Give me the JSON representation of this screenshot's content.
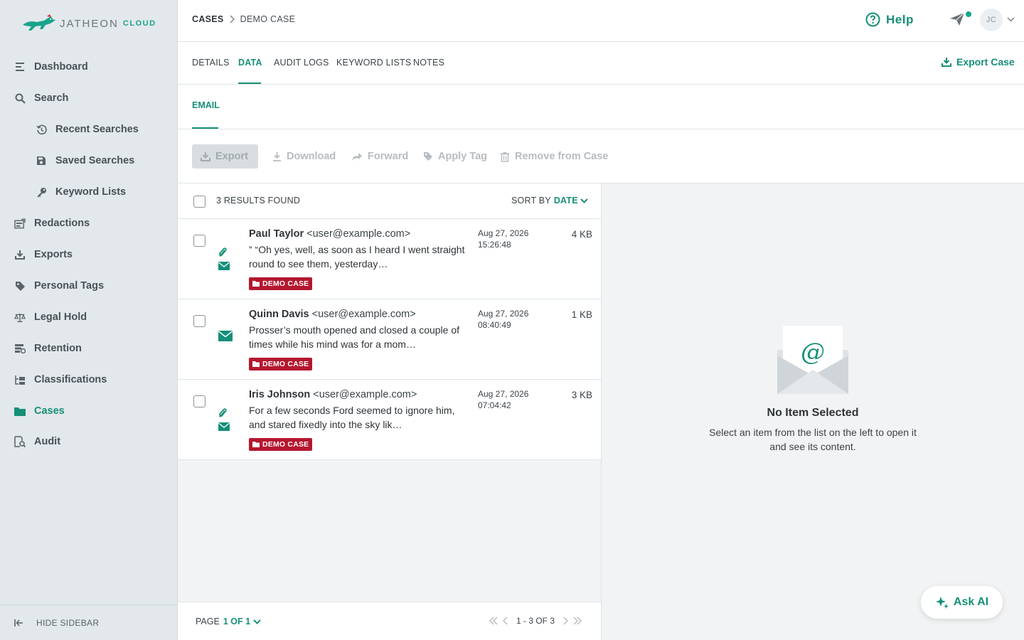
{
  "brand": {
    "name": "JATHEON",
    "sub": "CLOUD",
    "accent": "#168f78"
  },
  "sidebar": {
    "items": [
      {
        "label": "Dashboard",
        "icon": "dashboard-icon"
      },
      {
        "label": "Search",
        "icon": "search-icon"
      },
      {
        "label": "Recent Searches",
        "icon": "history-icon"
      },
      {
        "label": "Saved Searches",
        "icon": "save-icon"
      },
      {
        "label": "Keyword Lists",
        "icon": "key-icon"
      },
      {
        "label": "Redactions",
        "icon": "redaction-icon"
      },
      {
        "label": "Exports",
        "icon": "export-icon"
      },
      {
        "label": "Personal Tags",
        "icon": "tag-icon"
      },
      {
        "label": "Legal Hold",
        "icon": "scale-icon"
      },
      {
        "label": "Retention",
        "icon": "retention-icon"
      },
      {
        "label": "Classifications",
        "icon": "classification-icon"
      },
      {
        "label": "Cases",
        "icon": "folder-icon"
      },
      {
        "label": "Audit",
        "icon": "audit-icon"
      }
    ],
    "active": "Cases",
    "hide_label": "HIDE SIDEBAR"
  },
  "header": {
    "breadcrumb_root": "CASES",
    "breadcrumb_current": "DEMO CASE",
    "help_label": "Help",
    "avatar_initials": "JC"
  },
  "tabs": {
    "items": [
      "DETAILS",
      "DATA",
      "AUDIT LOGS",
      "KEYWORD LISTS",
      "NOTES"
    ],
    "active": "DATA",
    "export_case_label": "Export Case"
  },
  "subtabs": {
    "active": "EMAIL"
  },
  "toolbar": {
    "export": "Export",
    "download": "Download",
    "forward": "Forward",
    "apply_tag": "Apply Tag",
    "remove": "Remove from Case"
  },
  "list": {
    "results_label": "3 RESULTS FOUND",
    "sort_label": "SORT BY",
    "sort_value": "DATE",
    "rows": [
      {
        "name": "Paul Taylor",
        "email": "<user@example.com>",
        "snippet": "” “Oh yes, well, as soon as I heard I went straight round to see them, yesterday…",
        "tag": "DEMO CASE",
        "date": "Aug 27, 2026",
        "time": "15:26:48",
        "size": "4 KB",
        "has_attachment": true
      },
      {
        "name": "Quinn Davis",
        "email": "<user@example.com>",
        "snippet": "Prosser’s mouth opened and closed a couple of times while his mind was for a mom…",
        "tag": "DEMO CASE",
        "date": "Aug 27, 2026",
        "time": "08:40:49",
        "size": "1 KB",
        "has_attachment": false
      },
      {
        "name": "Iris Johnson",
        "email": "<user@example.com>",
        "snippet": "For a few seconds Ford seemed to ignore him, and stared fixedly into the sky lik…",
        "tag": "DEMO CASE",
        "date": "Aug 27, 2026",
        "time": "07:04:42",
        "size": "3 KB",
        "has_attachment": true
      }
    ],
    "page_label": "PAGE",
    "page_value": "1 OF 1",
    "range": "1 - 3 OF 3"
  },
  "preview": {
    "title": "No Item Selected",
    "subtitle": "Select an item from the list on the left to open it and see its content.",
    "ask_ai": "Ask AI"
  },
  "colors": {
    "accent": "#168f78",
    "tag": "#b4172f",
    "sidebar_bg": "#e2e8eb"
  }
}
